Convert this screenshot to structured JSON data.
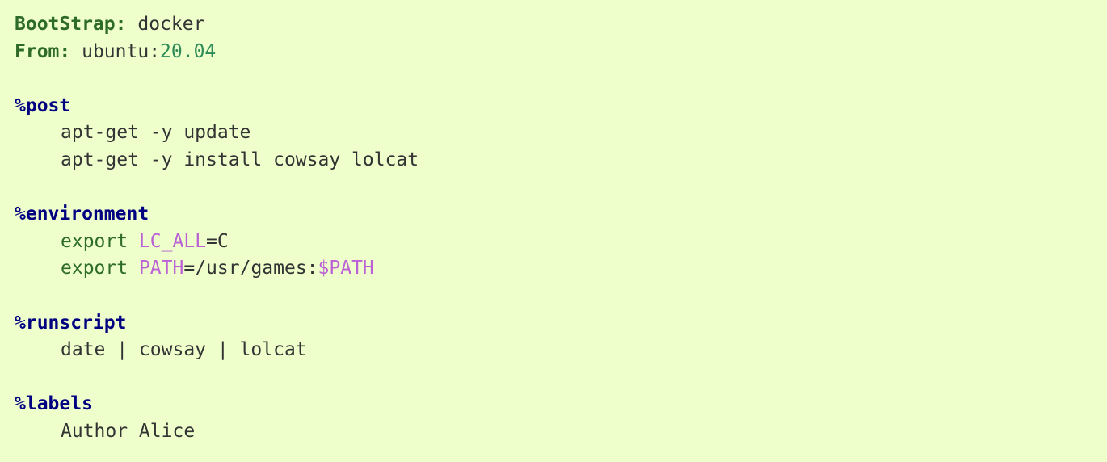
{
  "definition": {
    "header": {
      "bootstrap_key": "BootStrap:",
      "bootstrap_value": "docker",
      "from_key": "From:",
      "from_image": "ubuntu:",
      "from_tag": "20.04"
    },
    "post": {
      "section": "%post",
      "lines": [
        "apt-get -y update",
        "apt-get -y install cowsay lolcat"
      ]
    },
    "environment": {
      "section": "%environment",
      "export_keyword": "export",
      "var1_name": "LC_ALL",
      "var1_eq": "=",
      "var1_value": "C",
      "var2_name": "PATH",
      "var2_eq": "=",
      "var2_value": "/usr/games:",
      "var2_ref": "$PATH"
    },
    "runscript": {
      "section": "%runscript",
      "line": "date | cowsay | lolcat"
    },
    "labels": {
      "section": "%labels",
      "line": "Author Alice"
    }
  },
  "colors": {
    "background": "#eeffcc",
    "text": "#333333",
    "header_keyword": "#2e6b2a",
    "section": "#000080",
    "number": "#2e8b57",
    "variable": "#bb60d5"
  }
}
